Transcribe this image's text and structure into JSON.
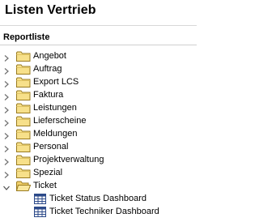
{
  "header": {
    "title": "Listen Vertrieb"
  },
  "section": {
    "label": "Reportliste"
  },
  "tree": {
    "folders": [
      {
        "label": "Angebot",
        "expanded": false
      },
      {
        "label": "Auftrag",
        "expanded": false
      },
      {
        "label": "Export LCS",
        "expanded": false
      },
      {
        "label": "Faktura",
        "expanded": false
      },
      {
        "label": "Leistungen",
        "expanded": false
      },
      {
        "label": "Lieferscheine",
        "expanded": false
      },
      {
        "label": "Meldungen",
        "expanded": false
      },
      {
        "label": "Personal",
        "expanded": false
      },
      {
        "label": "Projektverwaltung",
        "expanded": false
      },
      {
        "label": "Spezial",
        "expanded": false
      },
      {
        "label": "Ticket",
        "expanded": true
      }
    ],
    "ticket_children": [
      {
        "label": "Ticket Status Dashboard",
        "icon": "report-table-icon"
      },
      {
        "label": "Ticket Techniker Dashboard",
        "icon": "report-table-icon"
      }
    ]
  },
  "colors": {
    "folder_fill": "#f7e08a",
    "folder_stroke": "#9a7b20",
    "twisty": "#707070",
    "report_header": "#2c4a8a"
  }
}
